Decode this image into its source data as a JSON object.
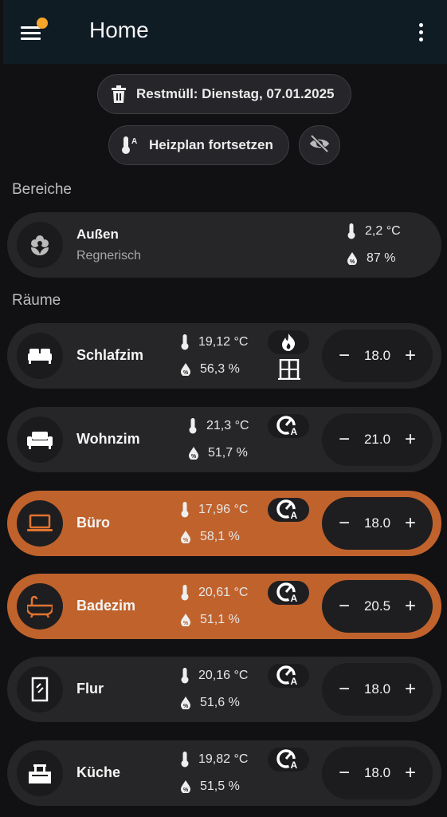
{
  "header": {
    "title": "Home"
  },
  "chips": {
    "trash": "Restmüll: Dienstag, 07.01.2025",
    "heatplan": "Heizplan fortsetzen"
  },
  "sections": {
    "areas": "Bereiche",
    "rooms": "Räume"
  },
  "outside": {
    "name": "Außen",
    "condition": "Regnerisch",
    "temperature": "2,2 °C",
    "humidity": "87 %"
  },
  "rooms": [
    {
      "name": "Schlafzim",
      "temperature": "19,12 °C",
      "humidity": "56,3 %",
      "setpoint": "18.0",
      "mode_icon": "fire-icon",
      "extra_icon": "window-icon",
      "active": false
    },
    {
      "name": "Wohnzim",
      "temperature": "21,3 °C",
      "humidity": "51,7 %",
      "setpoint": "21.0",
      "mode_icon": "auto-thermostat-icon",
      "active": false
    },
    {
      "name": "Büro",
      "temperature": "17,96 °C",
      "humidity": "58,1 %",
      "setpoint": "18.0",
      "mode_icon": "auto-thermostat-icon",
      "active": true
    },
    {
      "name": "Badezim",
      "temperature": "20,61 °C",
      "humidity": "51,1 %",
      "setpoint": "20.5",
      "mode_icon": "auto-thermostat-icon",
      "active": true
    },
    {
      "name": "Flur",
      "temperature": "20,16 °C",
      "humidity": "51,6 %",
      "setpoint": "18.0",
      "mode_icon": "auto-thermostat-icon",
      "active": false
    },
    {
      "name": "Küche",
      "temperature": "19,82 °C",
      "humidity": "51,5 %",
      "setpoint": "18.0",
      "mode_icon": "auto-thermostat-icon",
      "active": false
    }
  ],
  "stepper": {
    "minus": "−",
    "plus": "+"
  },
  "colors": {
    "active_card": "#c0622c",
    "card": "#262628",
    "background": "#111113",
    "badge": "#f7a52b"
  }
}
